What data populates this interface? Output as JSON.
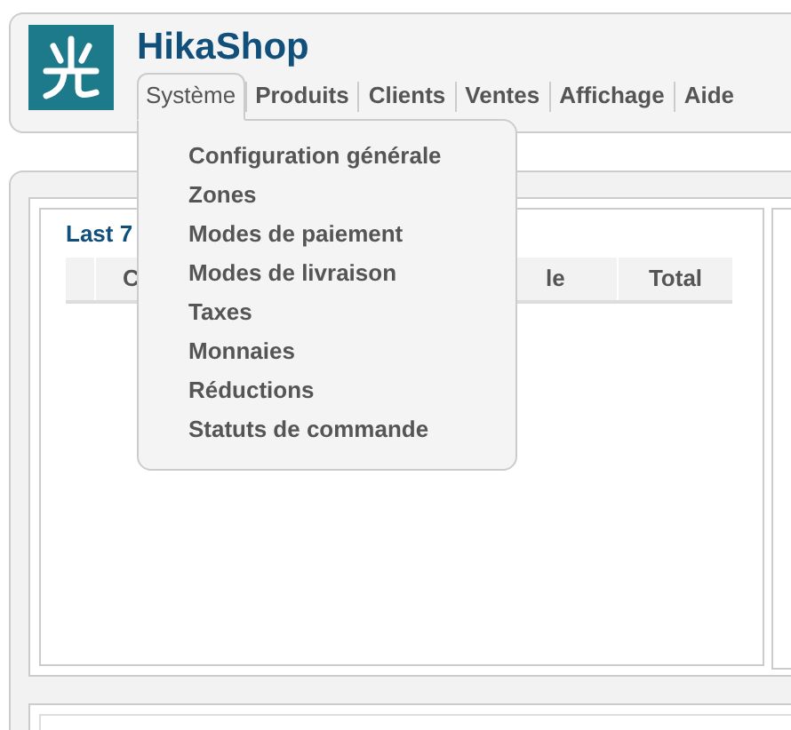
{
  "app": {
    "title": "HikaShop"
  },
  "menu": [
    {
      "label": "Système",
      "selected": true
    },
    {
      "label": "Produits",
      "selected": false
    },
    {
      "label": "Clients",
      "selected": false
    },
    {
      "label": "Ventes",
      "selected": false
    },
    {
      "label": "Affichage",
      "selected": false
    },
    {
      "label": "Aide",
      "selected": false
    }
  ],
  "dropdown": {
    "items": [
      "Configuration générale",
      "Zones",
      "Modes de paiement",
      "Modes de livraison",
      "Taxes",
      "Monnaies",
      "Réductions",
      "Statuts de commande"
    ]
  },
  "dashboard": {
    "panel_title": "Last 7",
    "table": {
      "columns": [
        "C",
        "le",
        "Total"
      ]
    }
  }
}
